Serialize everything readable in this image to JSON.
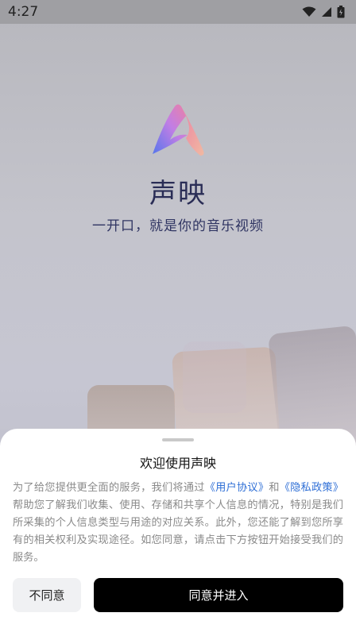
{
  "status_bar": {
    "time": "4:27"
  },
  "splash": {
    "app_name": "声映",
    "slogan": "一开口，就是你的音乐视频"
  },
  "dialog": {
    "title": "欢迎使用声映",
    "text_1": "为了给您提供更全面的服务，我们将通过",
    "user_agreement_link": "《用户协议》",
    "text_and": "和",
    "privacy_policy_link": "《隐私政策》",
    "text_2": "帮助您了解我们收集、使用、存储和共享个人信息的情况，特别是我们所采集的个人信息类型与用途的对应关系。此外，您还能了解到您所享有的相关权利及实现途径。如您同意，请点击下方按钮开始接受我们的服务。",
    "decline_button": "不同意",
    "accept_button": "同意并进入"
  },
  "colors": {
    "accent_link": "#2f6fd6",
    "logo_gradient": [
      "#4b6ef0",
      "#c277e8",
      "#f07aa0"
    ]
  }
}
